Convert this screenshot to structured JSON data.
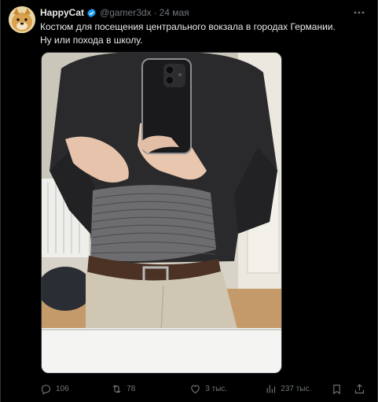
{
  "author": {
    "display_name": "HappyCat",
    "handle": "@gamer3dx",
    "separator": "·",
    "date": "24 мая",
    "verified_color": "#1d9bf0"
  },
  "tweet": {
    "text_line1": "Костюм для посещения центрального вокзала в городах Германии.",
    "text_line2": "Ну или похода в школу."
  },
  "media": {
    "icon": "photo-mirror-selfie"
  },
  "actions": {
    "replies": "106",
    "retweets": "78",
    "likes": "3 тыс.",
    "views": "237 тыс."
  },
  "colors": {
    "background": "#000000",
    "text_primary": "#e7e9ea",
    "text_secondary": "#71767b",
    "border": "#2f3336",
    "accent": "#1d9bf0"
  }
}
